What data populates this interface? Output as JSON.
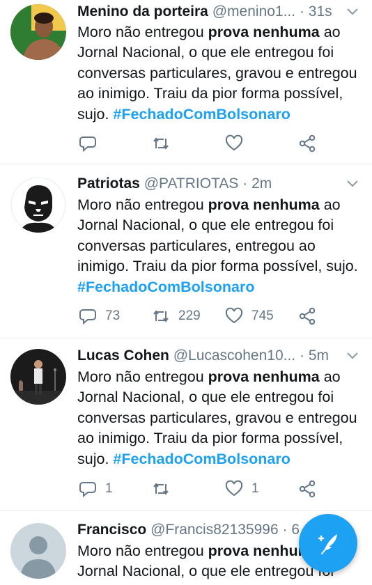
{
  "colors": {
    "accent": "#1da1f2",
    "secondary_text": "#657786",
    "primary_text": "#14171a",
    "divider": "#e6ecf0"
  },
  "tweets": [
    {
      "name": "Menino da porteira",
      "handle": "@menino1...",
      "separator": "·",
      "time": "31s",
      "text_before": "Moro não entregou ",
      "text_bold": "prova nenhuma",
      "text_after": " ao Jornal Nacional, o que ele entregou foi conversas particulares, gravou e entregou ao inimigo. Traiu da pior forma possível, sujo. ",
      "hashtag": "#FechadoComBolsonaro",
      "replies": "",
      "retweets": "",
      "likes": "",
      "avatar_icon": "user-photo"
    },
    {
      "name": "Patriotas",
      "handle": "@PATRIOTAS",
      "separator": "·",
      "time": "2m",
      "text_before": "Moro não entregou ",
      "text_bold": "prova nenhuma",
      "text_after": " ao Jornal Nacional, o que ele entregou foi conversas particulares, entregou ao inimigo. Traiu da pior forma possível, sujo. ",
      "hashtag": "#FechadoComBolsonaro",
      "replies": "73",
      "retweets": "229",
      "likes": "745",
      "avatar_icon": "face-portrait"
    },
    {
      "name": "Lucas Cohen",
      "handle": "@Lucascohen10...",
      "separator": "·",
      "time": "5m",
      "text_before": "Moro não entregou ",
      "text_bold": "prova nenhuma",
      "text_after": " ao Jornal Nacional, o que ele entregou foi conversas particulares, gravou e entregou ao inimigo. Traiu da pior forma possível, sujo. ",
      "hashtag": "#FechadoComBolsonaro",
      "replies": "1",
      "retweets": "",
      "likes": "1",
      "avatar_icon": "stage-photo"
    },
    {
      "name": "Francisco",
      "handle": "@Francis82135996",
      "separator": "·",
      "time": "6",
      "text_before": "Moro não entregou ",
      "text_bold": "prova nenhuma",
      "text_after": " ao Jornal Nacional, o que ele entregou foi",
      "hashtag": "",
      "replies": "",
      "retweets": "",
      "likes": "",
      "avatar_icon": "default-avatar"
    }
  ],
  "compose_button": {
    "icon": "compose-feather-icon"
  }
}
